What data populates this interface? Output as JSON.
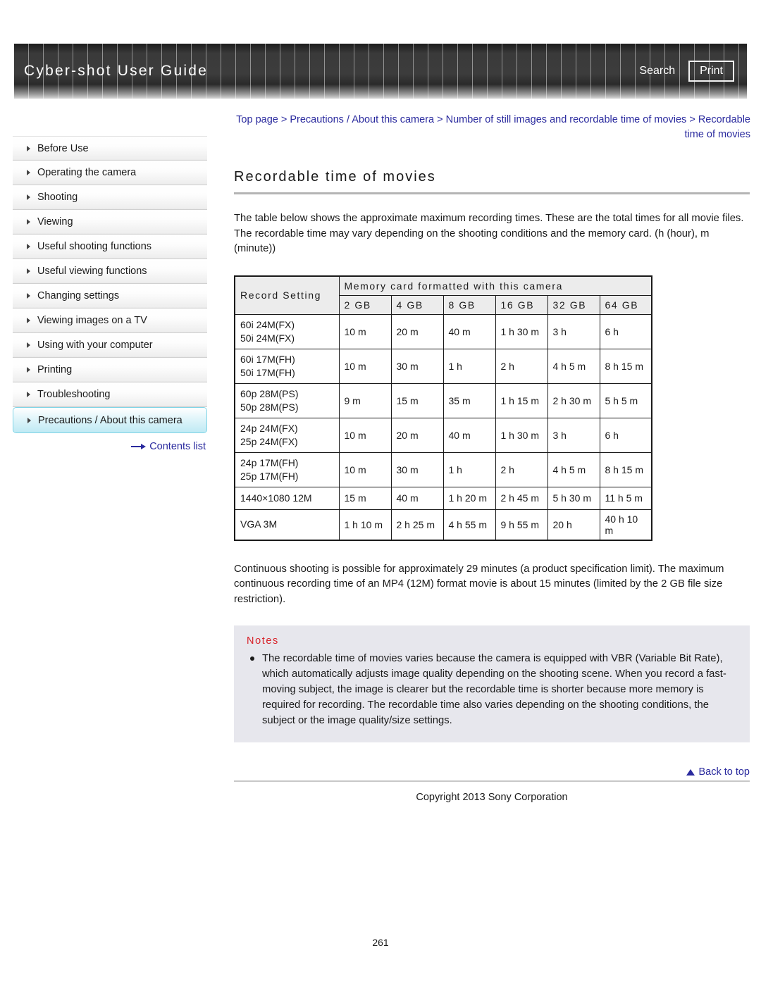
{
  "header": {
    "title": "Cyber-shot User Guide",
    "search_label": "Search",
    "print_label": "Print"
  },
  "breadcrumb": {
    "text": "Top page > Precautions / About this camera > Number of still images and recordable time of movies > Recordable time of movies",
    "color": "#2a2a9e"
  },
  "sidebar": {
    "items": [
      {
        "label": "Before Use",
        "selected": false
      },
      {
        "label": "Operating the camera",
        "selected": false
      },
      {
        "label": "Shooting",
        "selected": false
      },
      {
        "label": "Viewing",
        "selected": false
      },
      {
        "label": "Useful shooting functions",
        "selected": false
      },
      {
        "label": "Useful viewing functions",
        "selected": false
      },
      {
        "label": "Changing settings",
        "selected": false
      },
      {
        "label": "Viewing images on a TV",
        "selected": false
      },
      {
        "label": "Using with your computer",
        "selected": false
      },
      {
        "label": "Printing",
        "selected": false
      },
      {
        "label": "Troubleshooting",
        "selected": false
      },
      {
        "label": "Precautions / About this camera",
        "selected": true
      }
    ],
    "contents_link": "Contents list",
    "selected_highlight_color": "#bfeaf4"
  },
  "main": {
    "page_title": "Recordable time of movies",
    "intro_paragraph": "The table below shows the approximate maximum recording times. These are the total times for all movie files. The recordable time may vary depending on the shooting conditions and the memory card. (h (hour), m (minute))",
    "after_table_paragraph": "Continuous shooting is possible for approximately 29 minutes (a product specification limit). The maximum continuous recording time of an MP4 (12M) format movie is about 15 minutes (limited by the 2 GB file size restriction)."
  },
  "table": {
    "header_record_setting": "Record Setting",
    "header_group": "Memory card formatted with this camera",
    "capacity_columns": [
      "2 GB",
      "4 GB",
      "8 GB",
      "16 GB",
      "32 GB",
      "64 GB"
    ],
    "rows": [
      {
        "setting_line1": "60i 24M(FX)",
        "setting_line2": "50i 24M(FX)",
        "values": [
          "10 m",
          "20 m",
          "40 m",
          "1 h 30 m",
          "3 h",
          "6 h"
        ]
      },
      {
        "setting_line1": "60i 17M(FH)",
        "setting_line2": "50i 17M(FH)",
        "values": [
          "10 m",
          "30 m",
          "1 h",
          "2 h",
          "4 h 5 m",
          "8 h 15 m"
        ]
      },
      {
        "setting_line1": "60p 28M(PS)",
        "setting_line2": "50p 28M(PS)",
        "values": [
          "9 m",
          "15 m",
          "35 m",
          "1 h 15 m",
          "2 h 30 m",
          "5 h 5 m"
        ]
      },
      {
        "setting_line1": "24p 24M(FX)",
        "setting_line2": "25p 24M(FX)",
        "values": [
          "10 m",
          "20 m",
          "40 m",
          "1 h 30 m",
          "3 h",
          "6 h"
        ]
      },
      {
        "setting_line1": "24p 17M(FH)",
        "setting_line2": "25p 17M(FH)",
        "values": [
          "10 m",
          "30 m",
          "1 h",
          "2 h",
          "4 h 5 m",
          "8 h 15 m"
        ]
      },
      {
        "setting_line1": "1440×1080 12M",
        "setting_line2": "",
        "values": [
          "15 m",
          "40 m",
          "1 h 20 m",
          "2 h 45 m",
          "5 h 30 m",
          "11 h 5 m"
        ]
      },
      {
        "setting_line1": "VGA 3M",
        "setting_line2": "",
        "values": [
          "1 h 10 m",
          "2 h 25 m",
          "4 h 55 m",
          "9 h 55 m",
          "20 h",
          "40 h 10 m"
        ]
      }
    ]
  },
  "notes": {
    "title": "Notes",
    "title_color": "#d8232a",
    "background_color": "#e7e7ed",
    "items": [
      "The recordable time of movies varies because the camera is equipped with VBR (Variable Bit Rate), which automatically adjusts image quality depending on the shooting scene. When you record a fast-moving subject, the image is clearer but the recordable time is shorter because more memory is required for recording. The recordable time also varies depending on the shooting conditions, the subject or the image quality/size settings."
    ]
  },
  "footer": {
    "back_to_top": "Back to top",
    "copyright": "Copyright 2013 Sony Corporation",
    "page_number": "261"
  }
}
